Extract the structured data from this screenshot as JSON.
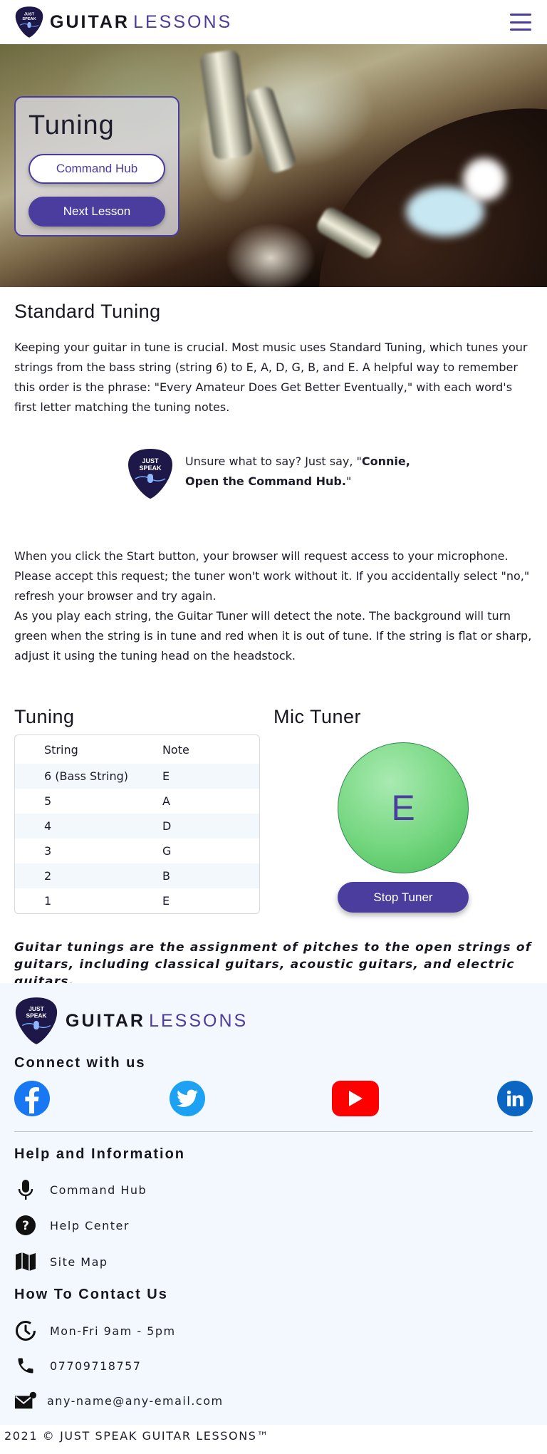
{
  "header": {
    "logo_badge_text": [
      "JUST",
      "SPEAK"
    ],
    "brand_word1": "GUITAR",
    "brand_word2": "LESSONS",
    "menu_icon": "hamburger-menu-icon"
  },
  "hero": {
    "title": "Tuning",
    "secondary_button": "Command Hub",
    "primary_button": "Next Lesson"
  },
  "standard_tuning": {
    "heading": "Standard Tuning",
    "paragraph": "Keeping your guitar in tune is crucial. Most music uses Standard Tuning, which tunes your strings from the bass string (string 6) to E, A, D, G, B, and E. A helpful way to remember this order is the phrase: \"Every Amateur Does Get Better Eventually,\" with each word's first letter matching the tuning notes."
  },
  "callout": {
    "prefix": "Unsure what to say? Just say, \"",
    "command": "Connie, Open the Command Hub.",
    "suffix": "\""
  },
  "instructions": {
    "paragraph1": "When you click the Start button, your browser will request access to your microphone. Please accept this request; the tuner won't work without it. If you accidentally select \"no,\" refresh your browser and try again.",
    "paragraph2": "As you play each string, the Guitar Tuner will detect the note. The background will turn green when the string is in tune and red when it is out of tune. If the string is flat or sharp, adjust it using the tuning head on the headstock."
  },
  "tuning_table": {
    "heading": "Tuning",
    "columns": [
      "String",
      "Note"
    ],
    "rows": [
      [
        "6 (Bass String)",
        "E"
      ],
      [
        "5",
        "A"
      ],
      [
        "4",
        "D"
      ],
      [
        "3",
        "G"
      ],
      [
        "2",
        "B"
      ],
      [
        "1",
        "E"
      ]
    ]
  },
  "mic_tuner": {
    "heading": "Mic Tuner",
    "detected_note": "E",
    "status_color": "#6fd47b",
    "button": "Stop Tuner"
  },
  "quote": "Guitar tunings are the assignment of pitches to the open strings of guitars, including classical guitars, acoustic guitars, and electric guitars.",
  "footer": {
    "brand_word1": "GUITAR",
    "brand_word2": "LESSONS",
    "connect_heading": "Connect with us",
    "social": [
      "facebook-icon",
      "twitter-icon",
      "youtube-icon",
      "linkedin-icon"
    ],
    "help_heading": "Help and Information",
    "help_links": [
      "Command Hub",
      "Help Center",
      "Site Map"
    ],
    "contact_heading": "How To Contact Us",
    "hours": "Mon-Fri 9am - 5pm",
    "phone": "07709718757",
    "email": "any-name@any-email.com",
    "copyright": "2021 © JUST SPEAK GUITAR LESSONS™"
  },
  "colors": {
    "accent": "#4a3d9e",
    "text": "#1c1c2a",
    "footer_bg": "#f3f8fe",
    "tuner_in_tune": "#6fd47b"
  }
}
